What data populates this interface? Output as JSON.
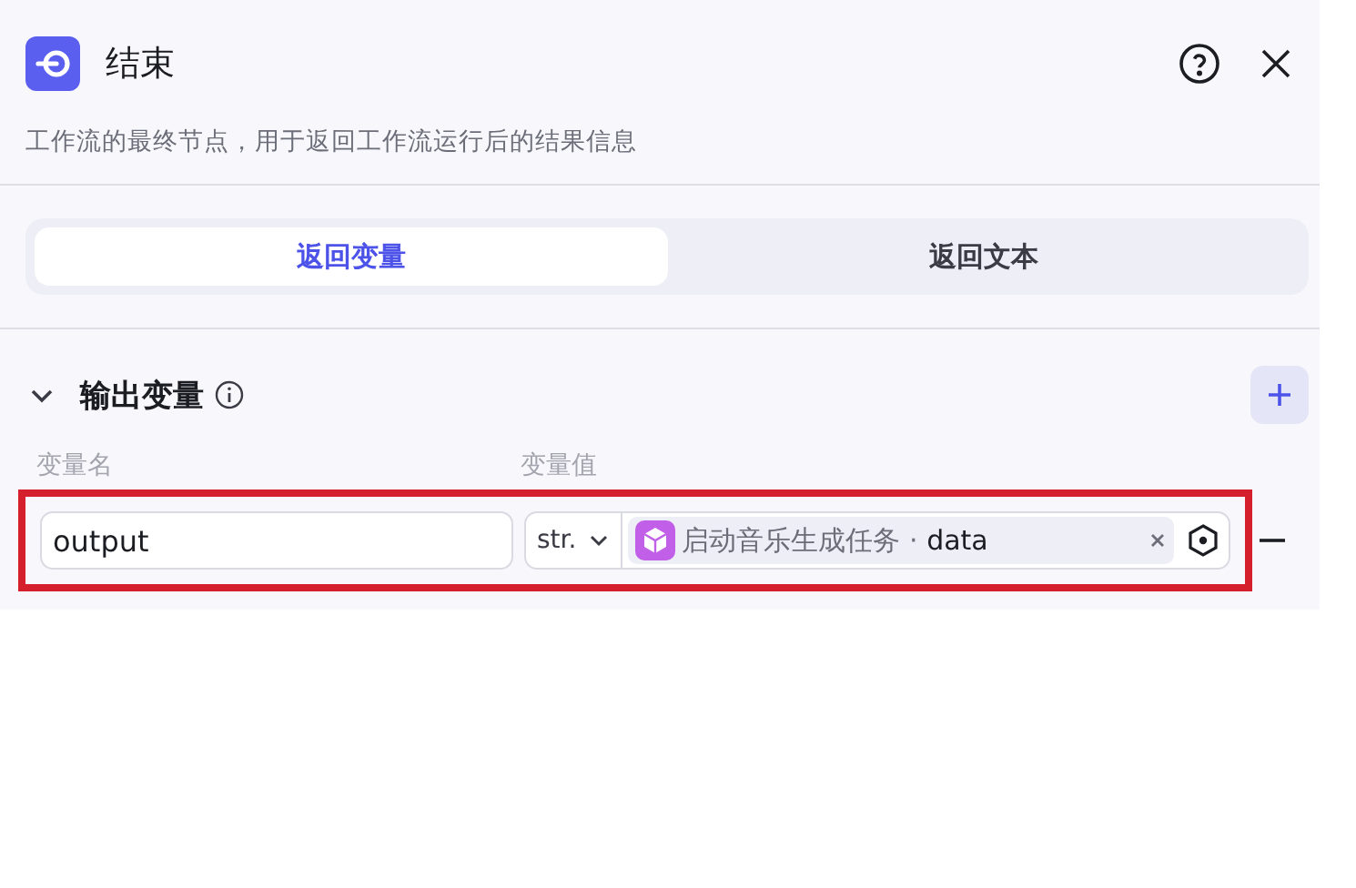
{
  "header": {
    "title": "结束",
    "description": "工作流的最终节点，用于返回工作流运行后的结果信息"
  },
  "tabs": [
    {
      "label": "返回变量",
      "selected": true
    },
    {
      "label": "返回文本",
      "selected": false
    }
  ],
  "section": {
    "title": "输出变量",
    "expanded": true,
    "columns": [
      "变量名",
      "变量值"
    ],
    "rows": [
      {
        "name": "output",
        "type": "str.",
        "source": "启动音乐生成任务",
        "separator": "·",
        "field": "data",
        "highlighted": true
      }
    ]
  }
}
